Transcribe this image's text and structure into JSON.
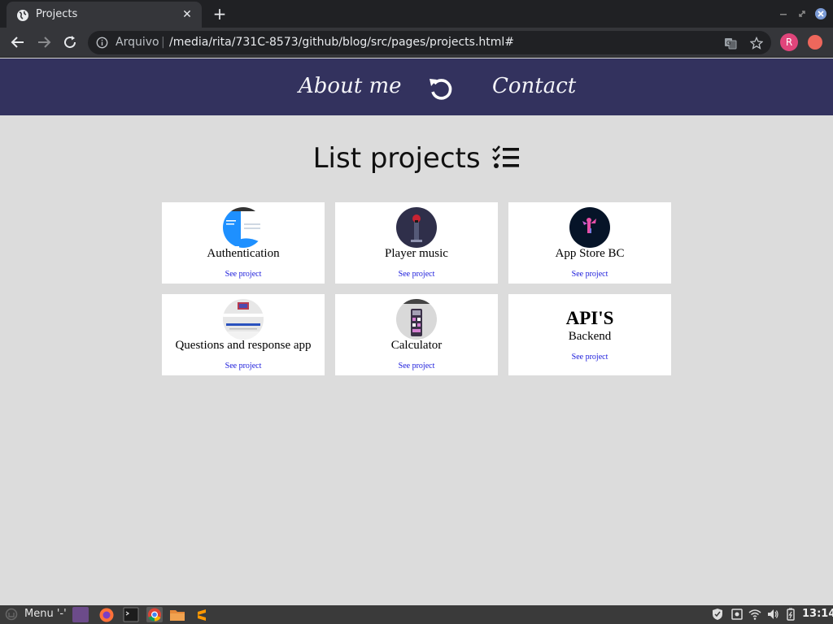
{
  "browser": {
    "tab_title": "Projects",
    "tab_close": "✕",
    "new_tab": "+",
    "scheme_label": "Arquivo",
    "separator": "|",
    "url": "/media/rita/731C-8573/github/blog/src/pages/projects.html#",
    "profile_initial": "R"
  },
  "nav": {
    "about": "About me",
    "contact": "Contact"
  },
  "main": {
    "heading": "List projects"
  },
  "projects": [
    {
      "title": "Authentication",
      "link": "See project"
    },
    {
      "title": "Player music",
      "link": "See project"
    },
    {
      "title": "App Store BC",
      "link": "See project"
    },
    {
      "title": "Questions and response app",
      "link": "See project"
    },
    {
      "title": "Calculator",
      "link": "See project"
    },
    {
      "title": "API'S",
      "subtitle": "Backend",
      "link": "See project"
    }
  ],
  "taskbar": {
    "menu_label": "Menu '-'",
    "clock": "13:14"
  },
  "colors": {
    "header_bg": "#33325e",
    "page_bg": "#dcdcdc",
    "link": "#1a1adb"
  }
}
